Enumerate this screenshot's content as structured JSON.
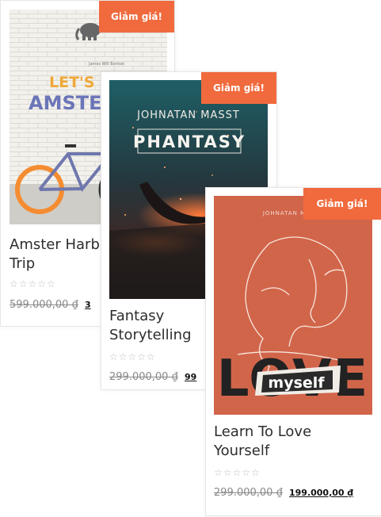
{
  "products": [
    {
      "badge": "Giảm giá!",
      "title_line1": "Amster Harbor",
      "title_line2": "Trip",
      "stars": "☆☆☆☆☆",
      "old_price": "599.000,00 ₫",
      "new_price": "3",
      "cover": {
        "author": "James Will Benton",
        "text1": "LET'S GO",
        "text2": "AMSTER"
      }
    },
    {
      "badge": "Giảm giá!",
      "title_line1": "Fantasy",
      "title_line2": "Storytelling",
      "stars": "☆☆☆☆☆",
      "old_price": "299.000,00 ₫",
      "new_price": "99",
      "cover": {
        "author": "JOHNATAN MASST",
        "title": "PHANTASY"
      }
    },
    {
      "badge": "Giảm giá!",
      "title_line1": "Learn To Love",
      "title_line2": "Yourself",
      "stars": "☆☆☆☆☆",
      "old_price": "299.000,00 ₫",
      "new_price": "199.000,00 ₫",
      "cover": {
        "author": "JOHNATAN MASST",
        "big": "LOVE",
        "sticker": "myself"
      }
    }
  ],
  "colors": {
    "badge": "#f06a3d",
    "cover3": "#d1654a"
  }
}
